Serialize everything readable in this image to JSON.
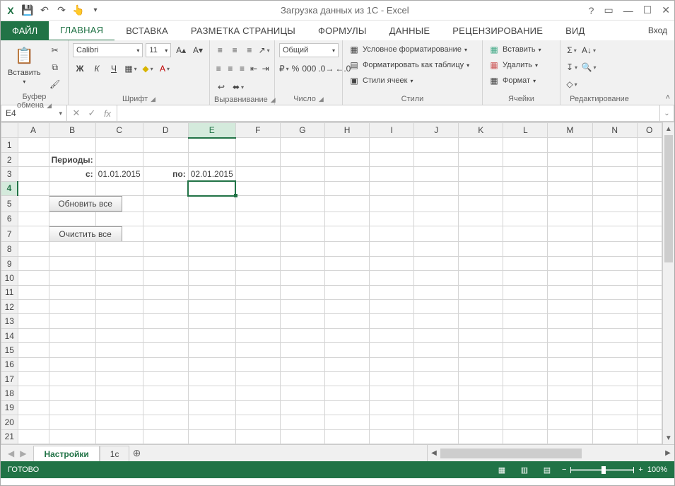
{
  "title": "Загрузка данных из 1С - Excel",
  "signin": "Вход",
  "tabs": {
    "file": "ФАЙЛ",
    "home": "ГЛАВНАЯ",
    "insert": "ВСТАВКА",
    "layout": "РАЗМЕТКА СТРАНИЦЫ",
    "formulas": "ФОРМУЛЫ",
    "data": "ДАННЫЕ",
    "review": "РЕЦЕНЗИРОВАНИЕ",
    "view": "ВИД"
  },
  "ribbon": {
    "clipboard": {
      "paste": "Вставить",
      "label": "Буфер обмена"
    },
    "font": {
      "name": "Calibri",
      "size": "11",
      "bold": "Ж",
      "italic": "К",
      "underline": "Ч",
      "label": "Шрифт"
    },
    "align": {
      "label": "Выравнивание"
    },
    "number": {
      "format": "Общий",
      "label": "Число"
    },
    "styles": {
      "cond": "Условное форматирование",
      "table": "Форматировать как таблицу",
      "cell": "Стили ячеек",
      "label": "Стили"
    },
    "cells": {
      "insert": "Вставить",
      "delete": "Удалить",
      "format": "Формат",
      "label": "Ячейки"
    },
    "edit": {
      "label": "Редактирование"
    }
  },
  "namebox": "E4",
  "columns": [
    "A",
    "B",
    "C",
    "D",
    "E",
    "F",
    "G",
    "H",
    "I",
    "J",
    "K",
    "L",
    "M",
    "N",
    "O"
  ],
  "rows": [
    "1",
    "2",
    "3",
    "4",
    "5",
    "6",
    "7",
    "8",
    "9",
    "10",
    "11",
    "12",
    "13",
    "14",
    "15",
    "16",
    "17",
    "18",
    "19",
    "20",
    "21"
  ],
  "cells": {
    "B2": "Периоды:",
    "B3": "с:",
    "C3": "01.01.2015",
    "D3": "по:",
    "E3": "02.01.2015",
    "btn_update": "Обновить все",
    "btn_clear": "Очистить все"
  },
  "sheets": {
    "active": "Настройки",
    "other": "1с"
  },
  "status": {
    "ready": "ГОТОВО",
    "zoom": "100%"
  }
}
